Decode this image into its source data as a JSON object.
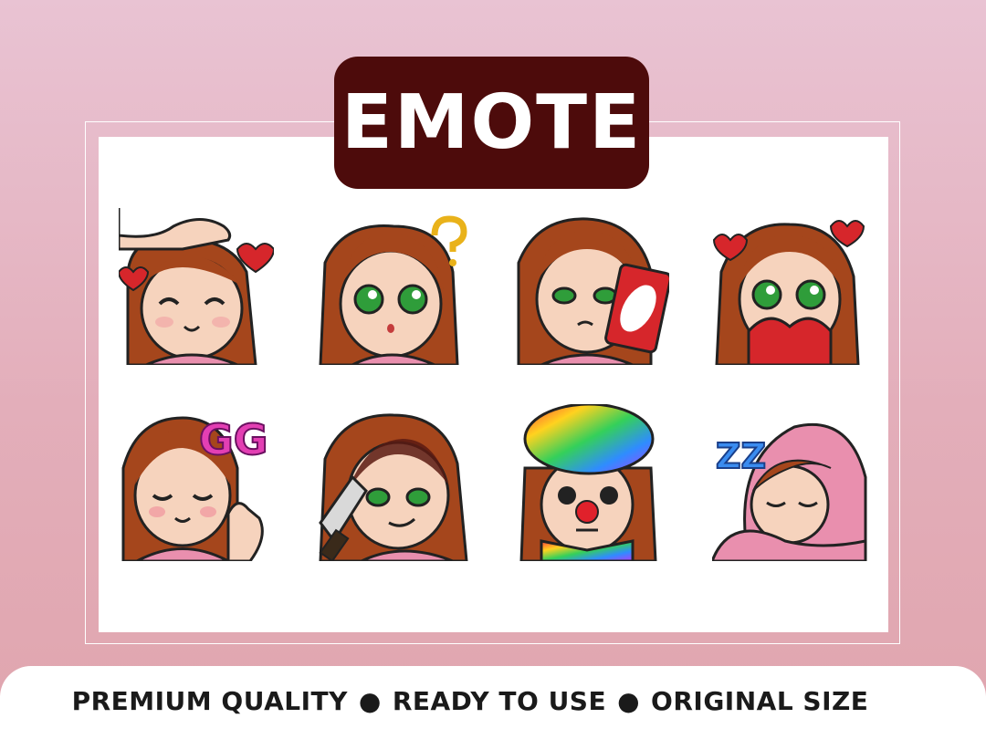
{
  "title": "EMOTE",
  "footer": {
    "item1": "PREMIUM QUALITY",
    "item2": "READY TO USE",
    "item3": "ORIGINAL SIZE",
    "separator": "●"
  },
  "emotes": [
    {
      "name": "headpat",
      "icon": "headpat-emote-icon"
    },
    {
      "name": "confused",
      "icon": "question-emote-icon"
    },
    {
      "name": "reverse-card",
      "icon": "reverse-card-emote-icon"
    },
    {
      "name": "love",
      "icon": "heart-emote-icon"
    },
    {
      "name": "gg",
      "icon": "gg-emote-icon",
      "text": "GG"
    },
    {
      "name": "knife",
      "icon": "knife-emote-icon"
    },
    {
      "name": "clown",
      "icon": "clown-emote-icon"
    },
    {
      "name": "sleep",
      "icon": "sleep-emote-icon",
      "text": "ZZ"
    }
  ],
  "colors": {
    "badge": "#4d0b0b",
    "hair": "#a5461c",
    "skin": "#f6d3bd",
    "shirt": "#e98fae",
    "eyes": "#2f9d3a",
    "heart": "#d6262b"
  }
}
